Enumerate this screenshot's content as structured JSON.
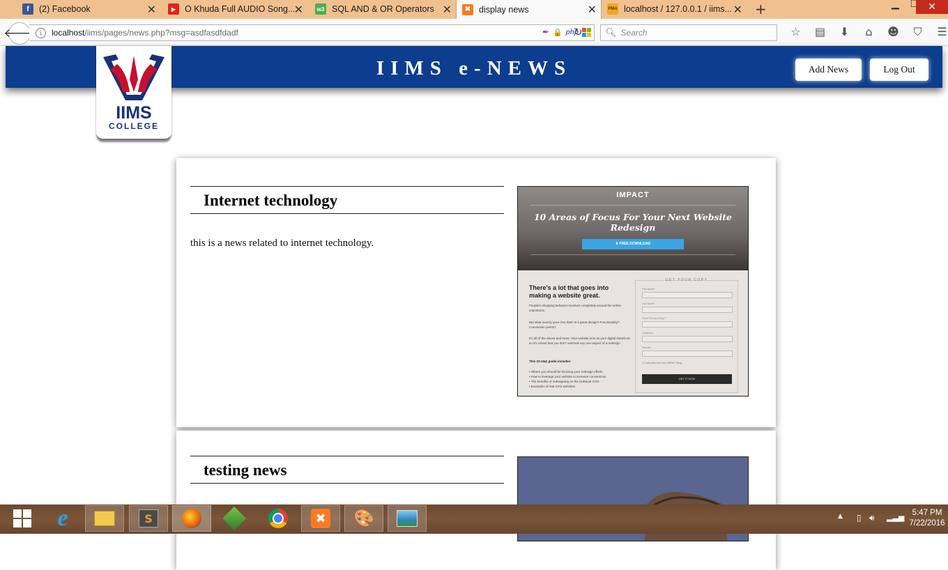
{
  "browser": {
    "tabs": [
      {
        "title": "(2) Facebook",
        "icon": "facebook-icon",
        "color": "#3b5998",
        "glyph": "f"
      },
      {
        "title": "O Khuda Full AUDIO Song...",
        "icon": "youtube-icon",
        "color": "#e62117",
        "glyph": "▶"
      },
      {
        "title": "SQL AND & OR Operators",
        "icon": "w3schools-icon",
        "color": "#4caf50",
        "glyph": "w3"
      },
      {
        "title": "display news",
        "icon": "xampp-icon",
        "color": "#fb7a24",
        "glyph": "✖"
      },
      {
        "title": "localhost / 127.0.0.1 / iims...",
        "icon": "phpmyadmin-icon",
        "color": "#f5a623",
        "glyph": "PMA"
      }
    ],
    "new_tab": "+",
    "url_host": "localhost",
    "url_path": "/iims/pages/news.php?msg=asdfasdfdadf",
    "search_placeholder": "Search"
  },
  "header": {
    "title": "IIMS e-NEWS",
    "add_news": "Add News",
    "log_out": "Log Out",
    "logo_line1": "IIMS",
    "logo_line2": "COLLEGE",
    "brand_color": "#0c3d8e"
  },
  "news": [
    {
      "title": "Internet technology",
      "body": "this is a news related to internet technology.",
      "image": {
        "brand": "IMPACT",
        "headline": "10 Areas of Focus For Your Next Website Redesign",
        "download": "FREE DOWNLOAD",
        "subhead": "There's a lot that goes into making a website great.",
        "p1": "People's shopping behavior revolves completely around the online experience.",
        "p2": "But what exactly goes into that? Is it great design? Functionality? Conversion points?",
        "p3": "It's all of the above and more. Your website acts as your digital storefront, so it's critical that you don't overlook any one aspect of a redesign.",
        "guide": "This 10-step guide includes:",
        "bullets": [
          "Where you should be focusing your redesign efforts",
          "How to leverage your website to increase conversions",
          "The benefits of redesigning on the HubSpot COS",
          "Examples of real COS websites"
        ],
        "form_title": "GET YOUR COPY",
        "fields": [
          "First Name*",
          "Last Name*",
          "Email  Privacy Policy*",
          "Company*",
          "Website"
        ],
        "subscribe": "Subscribe me to the IMPACT Blog",
        "cta": "GET IT NOW"
      }
    },
    {
      "title": "testing news"
    }
  ],
  "taskbar": {
    "time": "5:47 PM",
    "date": "7/22/2016"
  }
}
